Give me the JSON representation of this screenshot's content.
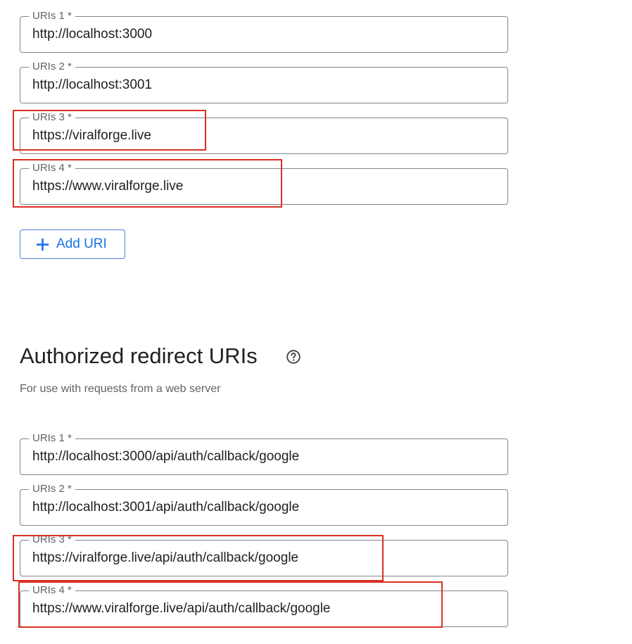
{
  "origins": {
    "fields": [
      {
        "label": "URIs 1 *",
        "value": "http://localhost:3000"
      },
      {
        "label": "URIs 2 *",
        "value": "http://localhost:3001"
      },
      {
        "label": "URIs 3 *",
        "value": "https://viralforge.live"
      },
      {
        "label": "URIs 4 *",
        "value": "https://www.viralforge.live"
      }
    ],
    "add_button_label": "Add URI"
  },
  "redirects": {
    "title": "Authorized redirect URIs",
    "help_icon": "help-circle-icon",
    "description": "For use with requests from a web server",
    "fields": [
      {
        "label": "URIs 1 *",
        "value": "http://localhost:3000/api/auth/callback/google"
      },
      {
        "label": "URIs 2 *",
        "value": "http://localhost:3001/api/auth/callback/google"
      },
      {
        "label": "URIs 3 *",
        "value": "https://viralforge.live/api/auth/callback/google"
      },
      {
        "label": "URIs 4 *",
        "value": "https://www.viralforge.live/api/auth/callback/google"
      }
    ]
  },
  "colors": {
    "accent": "#1a73e8",
    "highlight": "#d93025",
    "field_border": "#80868b",
    "text": "#202124",
    "muted_text": "#5f6368"
  }
}
